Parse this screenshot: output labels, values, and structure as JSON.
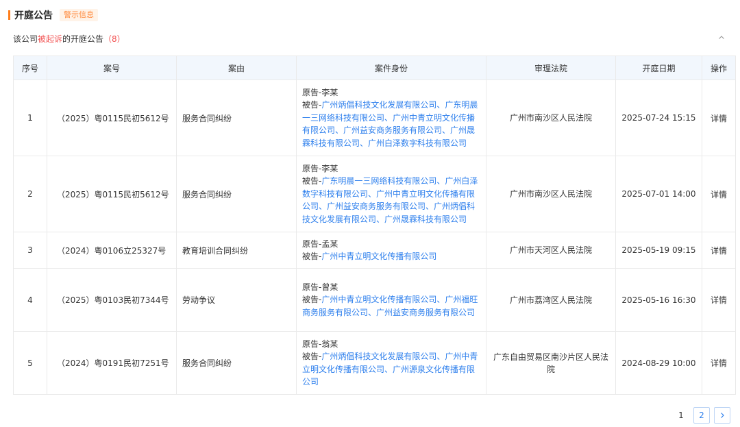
{
  "section": {
    "title": "开庭公告",
    "tag": "警示信息"
  },
  "subhead": {
    "prefix": "该公司",
    "highlight": "被起诉",
    "suffix": "的开庭公告",
    "count": "（8）"
  },
  "columns": [
    "序号",
    "案号",
    "案由",
    "案件身份",
    "审理法院",
    "开庭日期",
    "操作"
  ],
  "rows": [
    {
      "index": "1",
      "case_no": "（2025）粤0115民初5612号",
      "cause": "服务合同纠纷",
      "plaintiff_label": "原告-",
      "plaintiff": "李某",
      "defendant_label": "被告-",
      "defendants": "广州炳倡科技文化发展有限公司、广东明晨一三网络科技有限公司、广州中青立明文化传播有限公司、广州益安商务服务有限公司、广州晟霖科技有限公司、广州白泽数字科技有限公司",
      "court": "广州市南沙区人民法院",
      "date": "2025-07-24 15:15",
      "action": "详情"
    },
    {
      "index": "2",
      "case_no": "（2025）粤0115民初5612号",
      "cause": "服务合同纠纷",
      "plaintiff_label": "原告-",
      "plaintiff": "李某",
      "defendant_label": "被告-",
      "defendants": "广东明晨一三网络科技有限公司、广州白泽数字科技有限公司、广州中青立明文化传播有限公司、广州益安商务服务有限公司、广州炳倡科技文化发展有限公司、广州晟霖科技有限公司",
      "court": "广州市南沙区人民法院",
      "date": "2025-07-01 14:00",
      "action": "详情"
    },
    {
      "index": "3",
      "case_no": "（2024）粤0106立25327号",
      "cause": "教育培训合同纠纷",
      "plaintiff_label": "原告-",
      "plaintiff": "孟某",
      "defendant_label": "被告-",
      "defendants": "广州中青立明文化传播有限公司",
      "court": "广州市天河区人民法院",
      "date": "2025-05-19 09:15",
      "action": "详情"
    },
    {
      "index": "4",
      "case_no": "（2025）粤0103民初7344号",
      "cause": "劳动争议",
      "plaintiff_label": "原告-",
      "plaintiff": "曾某",
      "defendant_label": "被告-",
      "defendants": "广州中青立明文化传播有限公司、广州福旺商务服务有限公司、广州益安商务服务有限公司",
      "court": "广州市荔湾区人民法院",
      "date": "2025-05-16 16:30",
      "action": "详情"
    },
    {
      "index": "5",
      "case_no": "（2024）粤0191民初7251号",
      "cause": "服务合同纠纷",
      "plaintiff_label": "原告-",
      "plaintiff": "翁某",
      "defendant_label": "被告-",
      "defendants": "广州炳倡科技文化发展有限公司、广州中青立明文化传播有限公司、广州源泉文化传播有限公司",
      "court": "广东自由贸易区南沙片区人民法院",
      "date": "2024-08-29 10:00",
      "action": "详情"
    }
  ],
  "pagination": {
    "pages": [
      "1",
      "2"
    ],
    "current": "1",
    "next_icon": "chevron-right-icon"
  },
  "icons": {
    "collapse": "chevron-up-icon"
  },
  "colors": {
    "accent": "#ff7d1a",
    "link": "#2f80ed",
    "alert": "#f25353",
    "header_bg": "#f2f7fd"
  }
}
